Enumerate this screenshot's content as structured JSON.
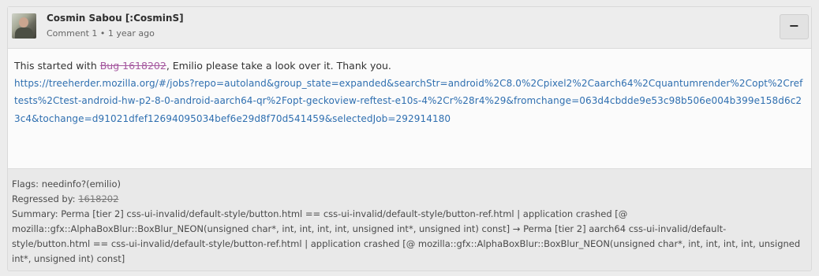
{
  "comment": {
    "author": "Cosmin Sabou [:CosminS]",
    "comment_number": "Comment 1",
    "separator": "•",
    "time": "1 year ago",
    "collapse_label": "−",
    "text_prefix": "This started with ",
    "bug_link": "Bug 1618202",
    "text_suffix": ", Emilio please take a look over it. Thank you.",
    "url": "https://treeherder.mozilla.org/#/jobs?repo=autoland&group_state=expanded&searchStr=android%2C8.0%2Cpixel2%2Caarch64%2Cquantumrender%2Copt%2Creftests%2Ctest-android-hw-p2-8-0-android-aarch64-qr%2Fopt-geckoview-reftest-e10s-4%2Cr%28r4%29&fromchange=063d4cbdde9e53c98b506e004b399e158d6c23c4&tochange=d91021dfef12694095034bef6e29d8f70d541459&selectedJob=292914180"
  },
  "footer": {
    "flags_label": "Flags:",
    "flags_value": "needinfo?(emilio)",
    "regressed_label": "Regressed by:",
    "regressed_value": "1618202",
    "summary_label": "Summary:",
    "summary_value": "Perma [tier 2] css-ui-invalid/default-style/button.html == css-ui-invalid/default-style/button-ref.html | application crashed [@ mozilla::gfx::AlphaBoxBlur::BoxBlur_NEON(unsigned char*, int, int, int, int, unsigned int*, unsigned int) const] → Perma [tier 2] aarch64 css-ui-invalid/default-style/button.html == css-ui-invalid/default-style/button-ref.html | application crashed [@ mozilla::gfx::AlphaBoxBlur::BoxBlur_NEON(unsigned char*, int, int, int, int, unsigned int*, unsigned int) const]"
  }
}
